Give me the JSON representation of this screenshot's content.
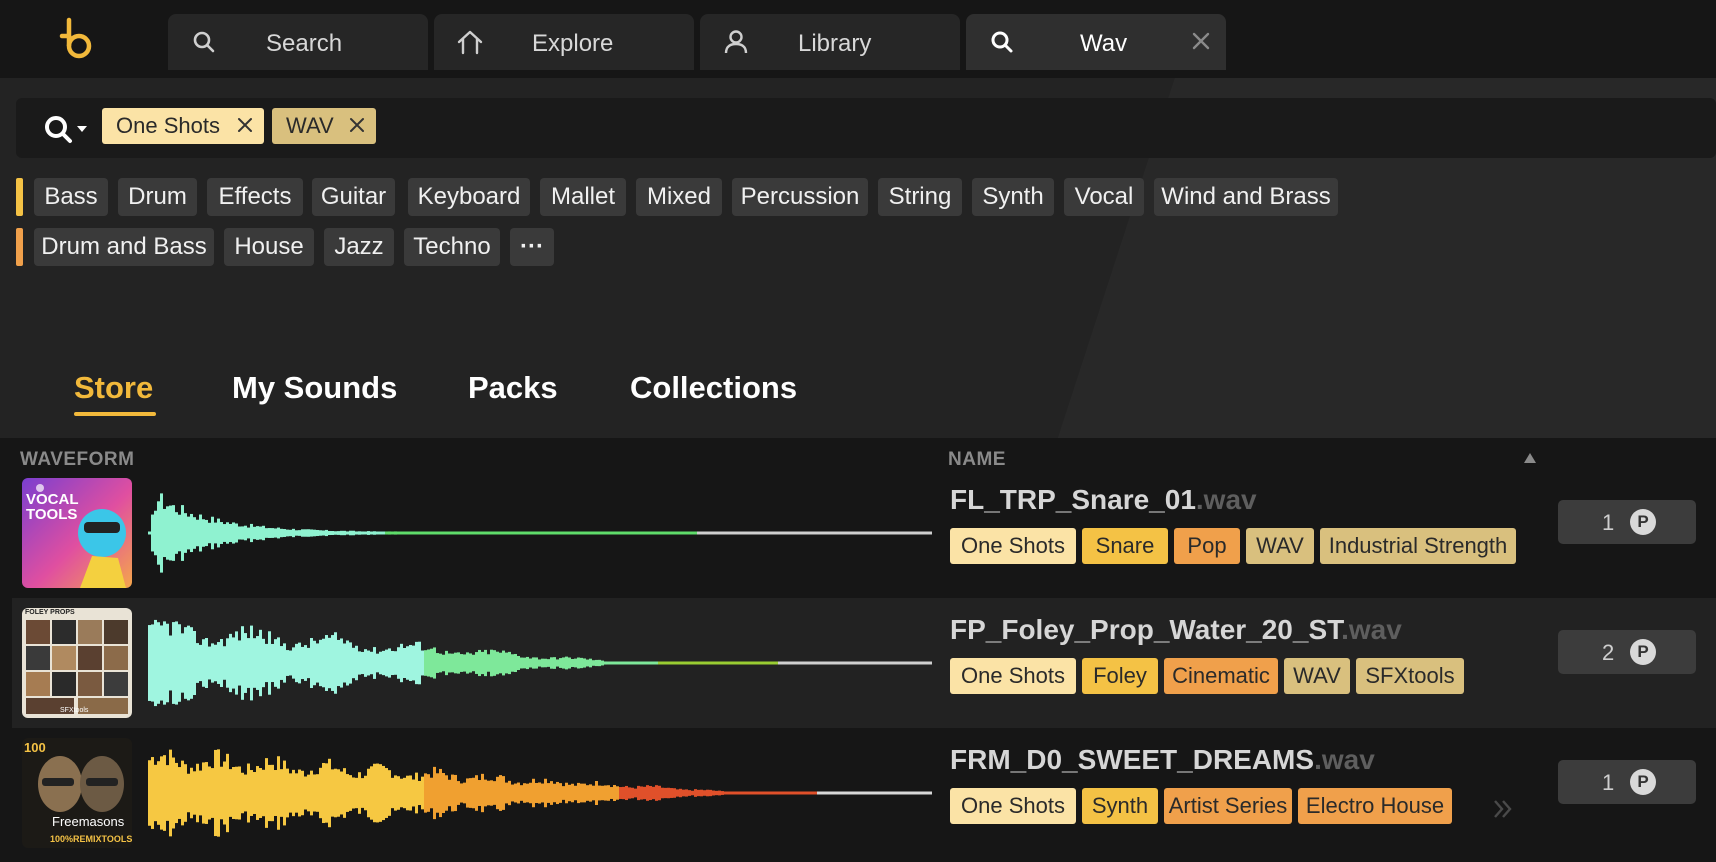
{
  "colors": {
    "accent": "#f2b93b",
    "chip_cream": "#fbe3a6",
    "chip_yellow": "#f4c245",
    "chip_orange": "#f0a04b",
    "chip_tan": "#d9c07e",
    "row_bar_yellow": "#f4c245",
    "row_bar_orange": "#f0a04b"
  },
  "tabs": [
    {
      "label": "Search",
      "icon": "search-icon"
    },
    {
      "label": "Explore",
      "icon": "home-icon"
    },
    {
      "label": "Library",
      "icon": "user-icon"
    },
    {
      "label": "Wav",
      "icon": "search-icon",
      "active": true
    }
  ],
  "search": {
    "active_chips": [
      "One Shots",
      "WAV"
    ]
  },
  "filters": {
    "instruments": [
      "Bass",
      "Drum",
      "Effects",
      "Guitar",
      "Keyboard",
      "Mallet",
      "Mixed",
      "Percussion",
      "String",
      "Synth",
      "Vocal",
      "Wind and Brass"
    ],
    "genres": [
      "Drum and Bass",
      "House",
      "Jazz",
      "Techno"
    ],
    "more_label": "···"
  },
  "subtabs": [
    "Store",
    "My Sounds",
    "Packs",
    "Collections"
  ],
  "columns": {
    "waveform": "WAVEFORM",
    "name": "NAME"
  },
  "rows": [
    {
      "name": "FL_TRP_Snare_01",
      "ext": ".wav",
      "tags": [
        "One Shots",
        "Snare",
        "Pop",
        "WAV",
        "Industrial Strength"
      ],
      "price": "1",
      "price_unit": "P",
      "thumb_text": [
        "VOCAL",
        "TOOLS"
      ]
    },
    {
      "name": "FP_Foley_Prop_Water_20_ST",
      "ext": ".wav",
      "tags": [
        "One Shots",
        "Foley",
        "Cinematic",
        "WAV",
        "SFXtools"
      ],
      "price": "2",
      "price_unit": "P",
      "thumb_text": [
        "FOLEY PROPS",
        "SFXtools"
      ]
    },
    {
      "name": "FRM_D0_SWEET_DREAMS",
      "ext": ".wav",
      "tags": [
        "One Shots",
        "Synth",
        "Artist Series",
        "Electro House"
      ],
      "price": "1",
      "price_unit": "P",
      "thumb_text": [
        "100",
        "Freemasons",
        "100%REMIXTOOLS"
      ]
    }
  ]
}
